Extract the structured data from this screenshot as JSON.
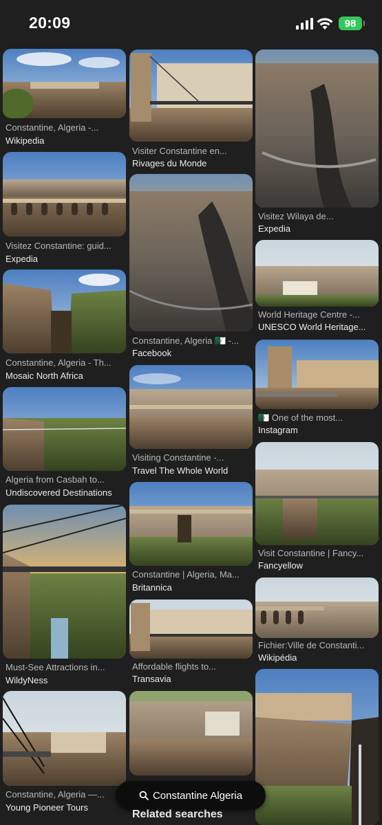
{
  "status_bar": {
    "time": "20:09",
    "battery": "98"
  },
  "results": {
    "col1": [
      {
        "caption": "Constantine, Algeria -...",
        "source": "Wikipedia"
      },
      {
        "caption": "Visitez Constantine: guid...",
        "source": "Expedia"
      },
      {
        "caption": "Constantine, Algeria - Th...",
        "source": "Mosaic North Africa"
      },
      {
        "caption": "Algeria from Casbah to...",
        "source": "Undiscovered Destinations"
      },
      {
        "caption": "Must-See Attractions in...",
        "source": "WildyNess"
      },
      {
        "caption": "Constantine, Algeria —...",
        "source": "Young Pioneer Tours"
      }
    ],
    "col2": [
      {
        "caption": "Visiter Constantine en...",
        "source": "Rivages du Monde"
      },
      {
        "caption": "Constantine, Algeria 🇩🇿 -...",
        "source": "Facebook"
      },
      {
        "caption": "Visiting Constantine -...",
        "source": "Travel The Whole World"
      },
      {
        "caption": "Constantine | Algeria, Ma...",
        "source": "Britannica"
      },
      {
        "caption": "Affordable flights to...",
        "source": "Transavia"
      }
    ],
    "col3": [
      {
        "caption": "Visitez Wilaya de...",
        "source": "Expedia"
      },
      {
        "caption": "World Heritage Centre -...",
        "source": "UNESCO World Heritage..."
      },
      {
        "caption": "🇩🇿 One of the most...",
        "source": "Instagram"
      },
      {
        "caption": "Visit Constantine | Fancy...",
        "source": "Fancyellow"
      },
      {
        "caption": "Fichier:Ville de Constanti...",
        "source": "Wikipédia"
      }
    ]
  },
  "search_chip": {
    "label": "Constantine Algeria"
  },
  "related_searches": "Related searches"
}
